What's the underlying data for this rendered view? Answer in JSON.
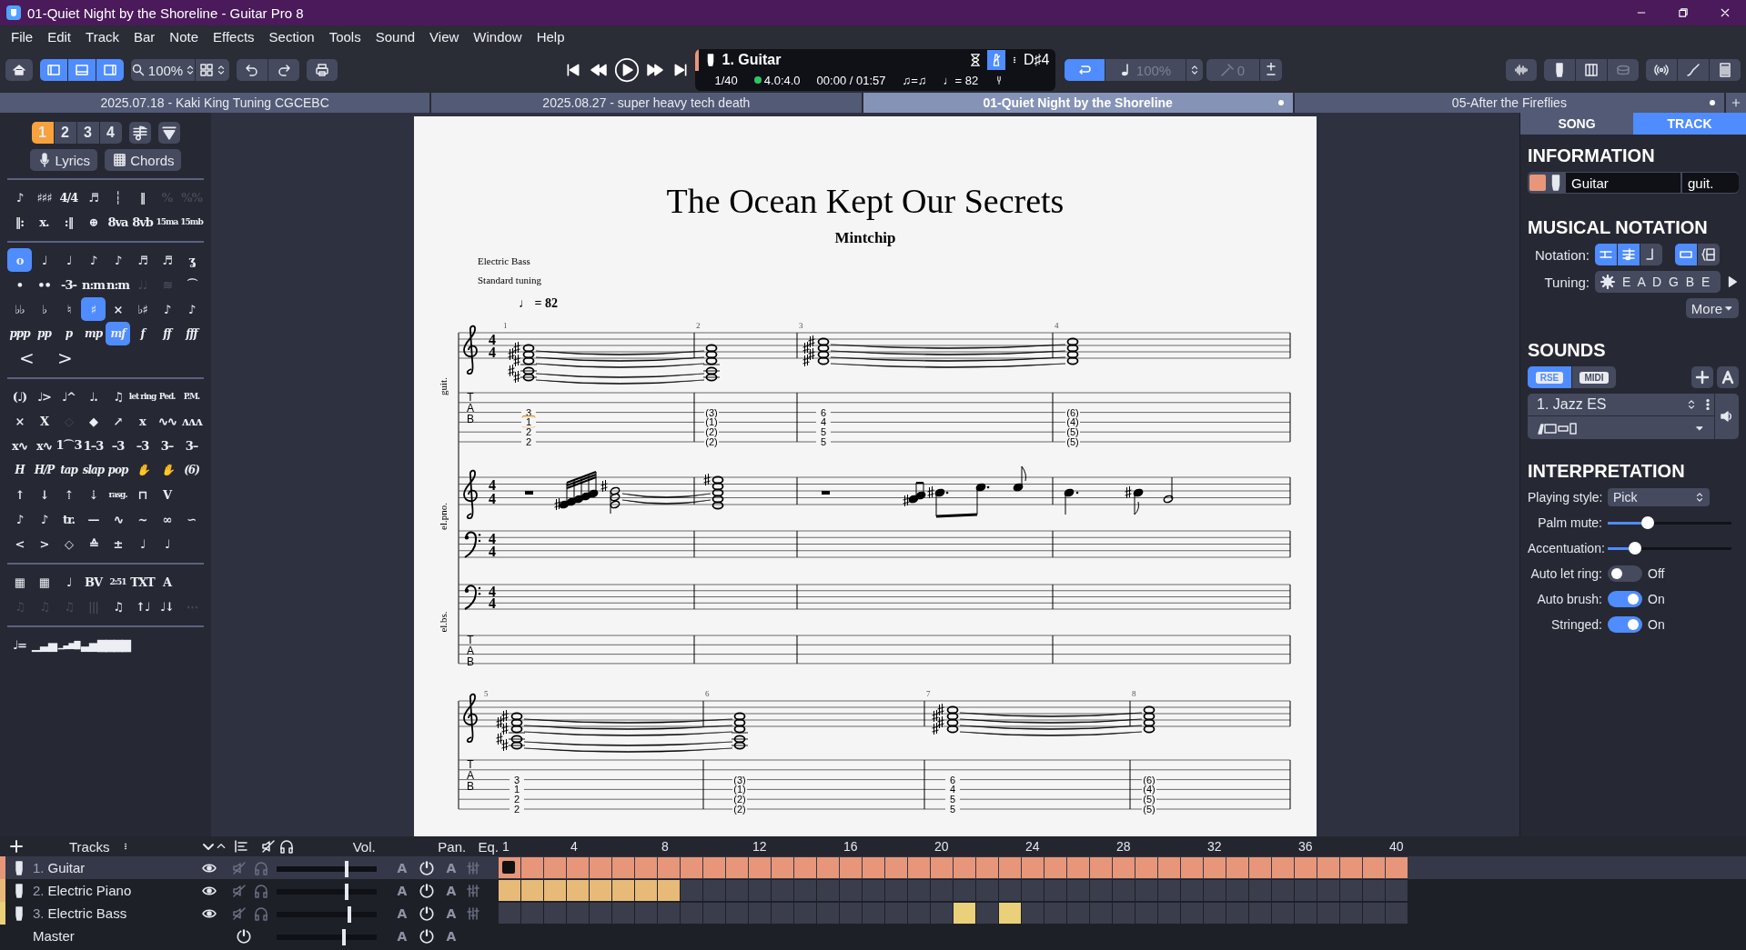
{
  "window": {
    "title": "01-Quiet Night by the Shoreline - Guitar Pro 8"
  },
  "menu": [
    "File",
    "Edit",
    "Track",
    "Bar",
    "Note",
    "Effects",
    "Section",
    "Tools",
    "Sound",
    "View",
    "Window",
    "Help"
  ],
  "toolbar": {
    "layout_buttons": [
      {
        "selected": true
      },
      {
        "selected": true
      },
      {
        "selected": true
      }
    ],
    "zoom": "100%",
    "track": "1. Guitar",
    "bar_position": "1/40",
    "time_signature": "4.0:4.0",
    "time": "00:00 / 01:57",
    "swing": "♫=♫",
    "tempo": "♩= 82",
    "key": "D♯4",
    "metronome_on": true,
    "loop_on": true,
    "speed": "100%",
    "transpose": "0"
  },
  "doc_tabs": [
    {
      "label": "2025.07.18 - Kaki King Tuning CGCEBC",
      "selected": false,
      "modified": false
    },
    {
      "label": "2025.08.27 - super heavy tech death",
      "selected": false,
      "modified": false
    },
    {
      "label": "01-Quiet Night by the Shoreline",
      "selected": true,
      "modified": true
    },
    {
      "label": "05-After the Fireflies",
      "selected": false,
      "modified": true
    }
  ],
  "palette": {
    "voices": [
      {
        "label": "1",
        "selected": true
      },
      {
        "label": "2",
        "selected": false
      },
      {
        "label": "3",
        "selected": false
      },
      {
        "label": "4",
        "selected": false
      }
    ],
    "lyrics": "Lyrics",
    "chords": "Chords",
    "sections": [
      [
        {
          "kind": "plain",
          "items": [
            {
              "text": "♪",
              "selected": false,
              "disabled": false
            },
            {
              "text": "♯♯♯",
              "selected": false,
              "disabled": false
            },
            {
              "text": "4/4",
              "selected": false,
              "disabled": false
            },
            {
              "text": "♬",
              "selected": false,
              "disabled": false
            },
            {
              "text": "┆",
              "selected": false,
              "disabled": false
            },
            {
              "text": "‖",
              "selected": false,
              "disabled": false
            },
            {
              "text": "%",
              "selected": false,
              "disabled": true
            },
            {
              "text": "%%",
              "selected": false,
              "disabled": true
            }
          ]
        },
        {
          "kind": "plain",
          "items": [
            {
              "text": "‖:",
              "selected": false,
              "disabled": false
            },
            {
              "text": "x.",
              "selected": false,
              "disabled": false
            },
            {
              "text": ":‖",
              "selected": false,
              "disabled": false
            },
            {
              "text": "⊕",
              "selected": false,
              "disabled": false
            },
            {
              "text": "8va",
              "selected": false,
              "disabled": false
            },
            {
              "text": "8vb",
              "selected": false,
              "disabled": false
            },
            {
              "text": "15ma",
              "selected": false,
              "disabled": false
            },
            {
              "text": "15mb",
              "selected": false,
              "disabled": false
            }
          ]
        }
      ],
      [
        {
          "kind": "plain",
          "items": [
            {
              "text": "o",
              "selected": true,
              "disabled": false
            },
            {
              "text": "♩",
              "selected": false,
              "disabled": false
            },
            {
              "text": "♩",
              "selected": false,
              "disabled": false
            },
            {
              "text": "♪",
              "selected": false,
              "disabled": false
            },
            {
              "text": "♪",
              "selected": false,
              "disabled": false
            },
            {
              "text": "♬",
              "selected": false,
              "disabled": false
            },
            {
              "text": "♬",
              "selected": false,
              "disabled": false
            },
            {
              "text": "ʓ",
              "selected": false,
              "disabled": false
            }
          ]
        },
        {
          "kind": "plain",
          "items": [
            {
              "text": "•",
              "selected": false,
              "disabled": false
            },
            {
              "text": "••",
              "selected": false,
              "disabled": false
            },
            {
              "text": "-3-",
              "selected": false,
              "disabled": false
            },
            {
              "text": "n:m",
              "selected": false,
              "disabled": false
            },
            {
              "text": "n:m",
              "selected": false,
              "disabled": false
            },
            {
              "text": "♩♩",
              "selected": false,
              "disabled": true
            },
            {
              "text": "≋",
              "selected": false,
              "disabled": true
            },
            {
              "text": "⌒",
              "selected": false,
              "disabled": false
            }
          ]
        },
        {
          "kind": "plain",
          "items": [
            {
              "text": "♭♭",
              "selected": false,
              "disabled": false
            },
            {
              "text": "♭",
              "selected": false,
              "disabled": false
            },
            {
              "text": "♮",
              "selected": false,
              "disabled": false
            },
            {
              "text": "♯",
              "selected": true,
              "disabled": false
            },
            {
              "text": "×",
              "selected": false,
              "disabled": false
            },
            {
              "text": "♭♯",
              "selected": false,
              "disabled": false
            },
            {
              "text": "♪",
              "selected": false,
              "disabled": false
            },
            {
              "text": "♪",
              "selected": false,
              "disabled": false
            }
          ]
        },
        {
          "kind": "italic",
          "items": [
            {
              "text": "ppp",
              "selected": false,
              "disabled": false
            },
            {
              "text": "pp",
              "selected": false,
              "disabled": false
            },
            {
              "text": "p",
              "selected": false,
              "disabled": false
            },
            {
              "text": "mp",
              "selected": false,
              "disabled": false
            },
            {
              "text": "mf",
              "selected": true,
              "disabled": false
            },
            {
              "text": "f",
              "selected": false,
              "disabled": false
            },
            {
              "text": "ff",
              "selected": false,
              "disabled": false
            },
            {
              "text": "fff",
              "selected": false,
              "disabled": false
            }
          ]
        },
        {
          "kind": "hairpin",
          "items": [
            {
              "text": "<",
              "selected": false,
              "disabled": false
            },
            {
              "text": ">",
              "selected": false,
              "disabled": false
            }
          ]
        }
      ],
      [
        {
          "kind": "plain",
          "items": [
            {
              "text": "(♩)",
              "selected": false,
              "disabled": false
            },
            {
              "text": "♩>",
              "selected": false,
              "disabled": false
            },
            {
              "text": "♩^",
              "selected": false,
              "disabled": false
            },
            {
              "text": "♩.",
              "selected": false,
              "disabled": false
            },
            {
              "text": "♫",
              "selected": false,
              "disabled": false
            },
            {
              "text": "let ring",
              "selected": false,
              "disabled": false
            },
            {
              "text": "Ped.",
              "selected": false,
              "disabled": false
            },
            {
              "text": "P.M.",
              "selected": false,
              "disabled": false
            }
          ]
        },
        {
          "kind": "plain",
          "items": [
            {
              "text": "×",
              "selected": false,
              "disabled": false
            },
            {
              "text": "X",
              "selected": false,
              "disabled": false
            },
            {
              "text": "◇",
              "selected": false,
              "disabled": true
            },
            {
              "text": "◆",
              "selected": false,
              "disabled": false
            },
            {
              "text": "↗",
              "selected": false,
              "disabled": false
            },
            {
              "text": "x",
              "selected": false,
              "disabled": false
            },
            {
              "text": "∿∿",
              "selected": false,
              "disabled": false
            },
            {
              "text": "ʌʌʌ",
              "selected": false,
              "disabled": false
            }
          ]
        },
        {
          "kind": "plain",
          "items": [
            {
              "text": "x∿",
              "selected": false,
              "disabled": false
            },
            {
              "text": "x∿",
              "selected": false,
              "disabled": false
            },
            {
              "text": "1⌒3",
              "selected": false,
              "disabled": false
            },
            {
              "text": "1–3",
              "selected": false,
              "disabled": false
            },
            {
              "text": "–3",
              "selected": false,
              "disabled": false
            },
            {
              "text": "–3",
              "selected": false,
              "disabled": false
            },
            {
              "text": "3–",
              "selected": false,
              "disabled": false
            },
            {
              "text": "3–",
              "selected": false,
              "disabled": false
            }
          ]
        },
        {
          "kind": "italic",
          "items": [
            {
              "text": "H",
              "selected": false,
              "disabled": false
            },
            {
              "text": "H/P",
              "selected": false,
              "disabled": false
            },
            {
              "text": "tap",
              "selected": false,
              "disabled": false
            },
            {
              "text": "slap",
              "selected": false,
              "disabled": false
            },
            {
              "text": "pop",
              "selected": false,
              "disabled": false
            },
            {
              "text": "✋",
              "selected": false,
              "disabled": false
            },
            {
              "text": "✋",
              "selected": false,
              "disabled": false
            },
            {
              "text": "(6)",
              "selected": false,
              "disabled": false
            }
          ]
        },
        {
          "kind": "plain",
          "items": [
            {
              "text": "↑",
              "selected": false,
              "disabled": false
            },
            {
              "text": "↓",
              "selected": false,
              "disabled": false
            },
            {
              "text": "⇡",
              "selected": false,
              "disabled": false
            },
            {
              "text": "⇣",
              "selected": false,
              "disabled": false
            },
            {
              "text": "rasg.",
              "selected": false,
              "disabled": false
            },
            {
              "text": "⊓",
              "selected": false,
              "disabled": false
            },
            {
              "text": "V",
              "selected": false,
              "disabled": false
            }
          ]
        },
        {
          "kind": "plain",
          "items": [
            {
              "text": "♪",
              "selected": false,
              "disabled": false
            },
            {
              "text": "♪",
              "selected": false,
              "disabled": false
            },
            {
              "text": "tr.",
              "selected": false,
              "disabled": false
            },
            {
              "text": "—",
              "selected": false,
              "disabled": false
            },
            {
              "text": "∿",
              "selected": false,
              "disabled": false
            },
            {
              "text": "~",
              "selected": false,
              "disabled": false
            },
            {
              "text": "∞",
              "selected": false,
              "disabled": false
            },
            {
              "text": "∽",
              "selected": false,
              "disabled": false
            }
          ]
        },
        {
          "kind": "plain",
          "items": [
            {
              "text": "<",
              "selected": false,
              "disabled": false
            },
            {
              "text": ">",
              "selected": false,
              "disabled": false
            },
            {
              "text": "◇",
              "selected": false,
              "disabled": false
            },
            {
              "text": "≙",
              "selected": false,
              "disabled": false
            },
            {
              "text": "±",
              "selected": false,
              "disabled": false
            },
            {
              "text": "♩",
              "selected": false,
              "disabled": false
            },
            {
              "text": "♩",
              "selected": false,
              "disabled": false
            }
          ]
        }
      ],
      [
        {
          "kind": "plain",
          "items": [
            {
              "text": "▦",
              "selected": false,
              "disabled": false
            },
            {
              "text": "▦",
              "selected": false,
              "disabled": false
            },
            {
              "text": "♩",
              "selected": false,
              "disabled": false
            },
            {
              "text": "BV",
              "selected": false,
              "disabled": false
            },
            {
              "text": "2:51",
              "selected": false,
              "disabled": false
            },
            {
              "text": "TXT",
              "selected": false,
              "disabled": false
            },
            {
              "text": "A",
              "selected": false,
              "disabled": false
            }
          ]
        },
        {
          "kind": "plain",
          "items": [
            {
              "text": "♫",
              "selected": false,
              "disabled": true
            },
            {
              "text": "♫",
              "selected": false,
              "disabled": true
            },
            {
              "text": "♫",
              "selected": false,
              "disabled": true
            },
            {
              "text": "|||",
              "selected": false,
              "disabled": true
            },
            {
              "text": "♫",
              "selected": false,
              "disabled": false
            },
            {
              "text": "↑♩",
              "selected": false,
              "disabled": false
            },
            {
              "text": "♩↓",
              "selected": false,
              "disabled": false
            },
            {
              "text": "⋯",
              "selected": false,
              "disabled": true
            }
          ]
        }
      ],
      [
        {
          "kind": "plain",
          "items": [
            {
              "text": "♩=",
              "selected": false,
              "disabled": false
            },
            {
              "text": "▁▃▅",
              "selected": false,
              "disabled": false
            },
            {
              "text": "▁▃▅▇",
              "selected": false,
              "disabled": false
            },
            {
              "text": "▃▅▇",
              "selected": false,
              "disabled": false
            },
            {
              "text": "▇▇▇",
              "selected": false,
              "disabled": false
            }
          ]
        }
      ]
    ]
  },
  "score": {
    "title": "The Ocean Kept Our Secrets",
    "artist": "Mintchip",
    "instrument": "Electric Bass",
    "tuning": "Standard tuning",
    "tempo": "♩ = 82",
    "systems": [
      {
        "labels": [
          "guit.",
          "el.pno.",
          "el.bs."
        ],
        "staves": [
          {
            "kind": "treble",
            "time": [
              "4",
              "4"
            ]
          },
          {
            "kind": "tab",
            "letters": [
              "T",
              "A",
              "B"
            ]
          },
          {
            "kind": "treble",
            "time": [
              "4",
              "4"
            ]
          },
          {
            "kind": "bass",
            "time": [
              "4",
              "4"
            ]
          },
          {
            "kind": "bass",
            "time": [
              "4",
              "4"
            ]
          },
          {
            "kind": "tab",
            "letters": [
              "T",
              "A",
              "B"
            ]
          }
        ],
        "bars": [
          {
            "number": "1",
            "frets": [
              {
                "text": "3",
                "selected": false
              },
              {
                "text": "1",
                "selected": true
              },
              {
                "text": "2",
                "selected": false
              },
              {
                "text": "2",
                "selected": false
              }
            ]
          },
          {
            "number": "2",
            "frets": [
              {
                "text": "(3)",
                "selected": false
              },
              {
                "text": "(1)",
                "selected": false
              },
              {
                "text": "(2)",
                "selected": false
              },
              {
                "text": "(2)",
                "selected": false
              }
            ]
          },
          {
            "number": "3",
            "frets": [
              {
                "text": "6",
                "selected": false
              },
              {
                "text": "4",
                "selected": false
              },
              {
                "text": "5",
                "selected": false
              },
              {
                "text": "5",
                "selected": false
              }
            ]
          },
          {
            "number": "4",
            "frets": [
              {
                "text": "(6)",
                "selected": false
              },
              {
                "text": "(4)",
                "selected": false
              },
              {
                "text": "(5)",
                "selected": false
              },
              {
                "text": "(5)",
                "selected": false
              }
            ]
          }
        ]
      },
      {
        "staves": [
          {
            "kind": "treble"
          },
          {
            "kind": "tab",
            "letters": [
              "T",
              "A",
              "B"
            ]
          }
        ],
        "bars": [
          {
            "number": "5",
            "frets": [
              {
                "text": "3",
                "selected": false
              },
              {
                "text": "1",
                "selected": false
              },
              {
                "text": "2",
                "selected": false
              },
              {
                "text": "2",
                "selected": false
              }
            ]
          },
          {
            "number": "6",
            "frets": [
              {
                "text": "(3)",
                "selected": false
              },
              {
                "text": "(1)",
                "selected": false
              },
              {
                "text": "(2)",
                "selected": false
              },
              {
                "text": "(2)",
                "selected": false
              }
            ]
          },
          {
            "number": "7",
            "frets": [
              {
                "text": "6",
                "selected": false
              },
              {
                "text": "4",
                "selected": false
              },
              {
                "text": "5",
                "selected": false
              },
              {
                "text": "5",
                "selected": false
              }
            ]
          },
          {
            "number": "8",
            "frets": [
              {
                "text": "(6)",
                "selected": false
              },
              {
                "text": "(4)",
                "selected": false
              },
              {
                "text": "(5)",
                "selected": false
              },
              {
                "text": "(5)",
                "selected": false
              }
            ]
          }
        ]
      }
    ]
  },
  "inspector": {
    "tabs": [
      {
        "label": "SONG",
        "selected": false
      },
      {
        "label": "TRACK",
        "selected": true
      }
    ],
    "information": {
      "heading": "INFORMATION",
      "color": "#e8967a",
      "name": "Guitar",
      "short_name": "guit."
    },
    "notation": {
      "heading": "MUSICAL NOTATION",
      "label": "Notation:",
      "modes": [
        {
          "selected": true
        },
        {
          "selected": true
        },
        {
          "selected": false
        }
      ],
      "layouts": [
        {
          "selected": true
        },
        {
          "selected": false
        }
      ],
      "tuning_label": "Tuning:",
      "tuning": "E A D G B E",
      "more": "More"
    },
    "sounds": {
      "heading": "SOUNDS",
      "engines": [
        {
          "label": "RSE",
          "selected": true
        },
        {
          "label": "MIDI",
          "selected": false
        }
      ],
      "preset": "1. Jazz ES"
    },
    "interpretation": {
      "heading": "INTERPRETATION",
      "rows": [
        {
          "kind": "select",
          "label": "Playing style:",
          "value": "Pick"
        },
        {
          "kind": "slider",
          "label": "Palm mute:",
          "level": 0.32
        },
        {
          "kind": "slider",
          "label": "Accentuation:",
          "level": 0.22
        },
        {
          "kind": "toggle",
          "label": "Auto let ring:",
          "on": false,
          "value": "Off"
        },
        {
          "kind": "toggle",
          "label": "Auto brush:",
          "on": true,
          "value": "On"
        },
        {
          "kind": "toggle",
          "label": "Stringed:",
          "on": true,
          "value": "On"
        }
      ]
    }
  },
  "tracks_panel": {
    "title": "Tracks",
    "vol": "Vol.",
    "pan": "Pan.",
    "eq": "Eq.",
    "bar_numbers": [
      "1",
      "4",
      "8",
      "12",
      "16",
      "20",
      "24",
      "28",
      "32",
      "36",
      "40"
    ],
    "tracks": [
      {
        "number": "1.",
        "name": "Guitar",
        "color": "#e8967a",
        "selected": true,
        "visible": true,
        "level": 0.7,
        "volume_automation": "A",
        "pan_automation": "A",
        "bars": [
          true,
          true,
          true,
          true,
          true,
          true,
          true,
          true,
          true,
          true,
          true,
          true,
          true,
          true,
          true,
          true,
          true,
          true,
          true,
          true,
          true,
          true,
          true,
          true,
          true,
          true,
          true,
          true,
          true,
          true,
          true,
          true,
          true,
          true,
          true,
          true,
          true,
          true,
          true,
          true
        ]
      },
      {
        "number": "2.",
        "name": "Electric Piano",
        "color": "#e8ba78",
        "selected": false,
        "visible": true,
        "level": 0.7,
        "volume_automation": "A",
        "pan_automation": "A",
        "bars": [
          true,
          true,
          true,
          true,
          true,
          true,
          true,
          true,
          false,
          false,
          false,
          false,
          false,
          false,
          false,
          false,
          false,
          false,
          false,
          false,
          false,
          false,
          false,
          false,
          false,
          false,
          false,
          false,
          false,
          false,
          false,
          false,
          false,
          false,
          false,
          false,
          false,
          false,
          false,
          false
        ]
      },
      {
        "number": "3.",
        "name": "Electric Bass",
        "color": "#ead078",
        "selected": false,
        "visible": true,
        "level": 0.73,
        "volume_automation": "A",
        "pan_automation": "A",
        "bars": [
          false,
          false,
          false,
          false,
          false,
          false,
          false,
          false,
          false,
          false,
          false,
          false,
          false,
          false,
          false,
          false,
          false,
          false,
          false,
          false,
          true,
          false,
          true,
          false,
          false,
          false,
          false,
          false,
          false,
          false,
          false,
          false,
          false,
          false,
          false,
          false,
          false,
          false,
          false,
          false
        ]
      }
    ],
    "master": {
      "name": "Master",
      "level": 0.67,
      "volume_automation": "A",
      "pan_automation": "A"
    }
  }
}
